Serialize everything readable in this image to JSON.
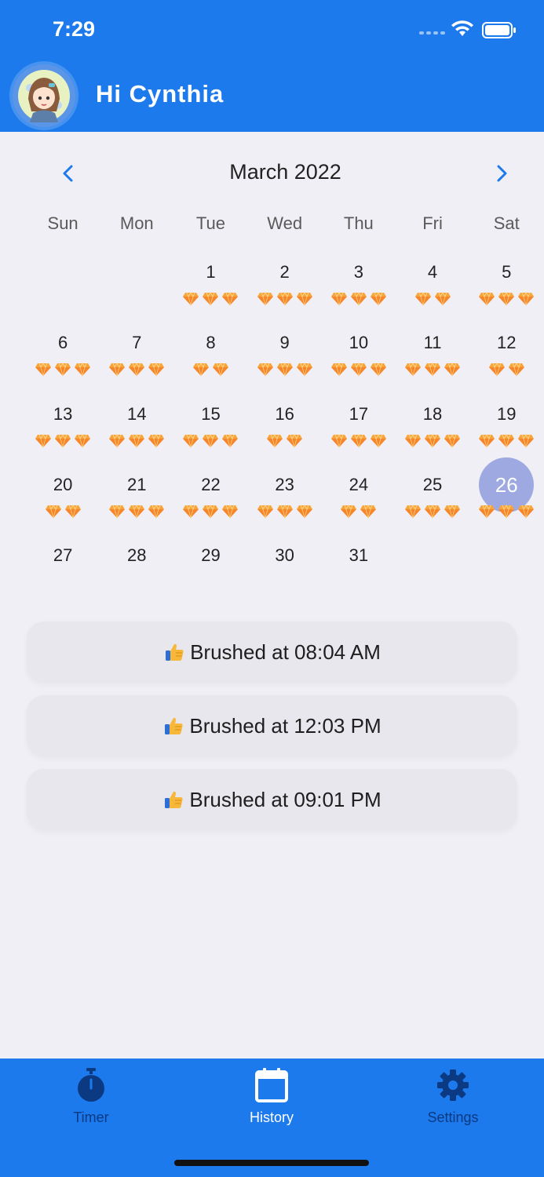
{
  "status_bar": {
    "time": "7:29"
  },
  "header": {
    "greeting": "Hi Cynthia"
  },
  "calendar": {
    "month_title": "March 2022",
    "weekdays": [
      "Sun",
      "Mon",
      "Tue",
      "Wed",
      "Thu",
      "Fri",
      "Sat"
    ],
    "leading_blanks": 2,
    "selected_day": 26,
    "days": [
      {
        "day": "1",
        "gems": 3
      },
      {
        "day": "2",
        "gems": 3
      },
      {
        "day": "3",
        "gems": 3
      },
      {
        "day": "4",
        "gems": 2
      },
      {
        "day": "5",
        "gems": 3
      },
      {
        "day": "6",
        "gems": 3
      },
      {
        "day": "7",
        "gems": 3
      },
      {
        "day": "8",
        "gems": 2
      },
      {
        "day": "9",
        "gems": 3
      },
      {
        "day": "10",
        "gems": 3
      },
      {
        "day": "11",
        "gems": 3
      },
      {
        "day": "12",
        "gems": 2
      },
      {
        "day": "13",
        "gems": 3
      },
      {
        "day": "14",
        "gems": 3
      },
      {
        "day": "15",
        "gems": 3
      },
      {
        "day": "16",
        "gems": 2
      },
      {
        "day": "17",
        "gems": 3
      },
      {
        "day": "18",
        "gems": 3
      },
      {
        "day": "19",
        "gems": 3
      },
      {
        "day": "20",
        "gems": 2
      },
      {
        "day": "21",
        "gems": 3
      },
      {
        "day": "22",
        "gems": 3
      },
      {
        "day": "23",
        "gems": 3
      },
      {
        "day": "24",
        "gems": 2
      },
      {
        "day": "25",
        "gems": 3
      },
      {
        "day": "26",
        "gems": 3
      },
      {
        "day": "27",
        "gems": 0
      },
      {
        "day": "28",
        "gems": 0
      },
      {
        "day": "29",
        "gems": 0
      },
      {
        "day": "30",
        "gems": 0
      },
      {
        "day": "31",
        "gems": 0
      }
    ]
  },
  "records": [
    {
      "text": "Brushed at 08:04 AM"
    },
    {
      "text": "Brushed at 12:03 PM"
    },
    {
      "text": "Brushed at 09:01 PM"
    }
  ],
  "tabs": [
    {
      "label": "Timer",
      "icon": "stopwatch-icon",
      "active": false
    },
    {
      "label": "History",
      "icon": "calendar-icon",
      "active": true
    },
    {
      "label": "Settings",
      "icon": "gear-icon",
      "active": false
    }
  ],
  "colors": {
    "primary": "#1d7aec",
    "selected_day": "#9da9e0",
    "gem": "#f7a53a"
  }
}
